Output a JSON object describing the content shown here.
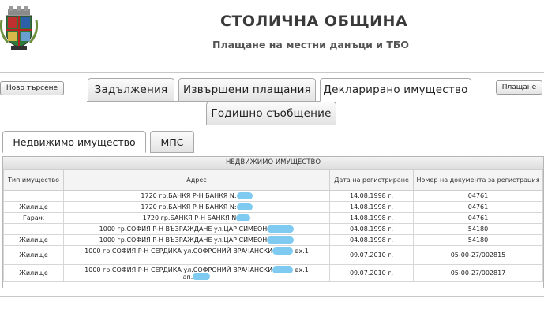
{
  "header": {
    "title": "СТОЛИЧНА ОБЩИНА",
    "subtitle": "Плащане на местни данъци и ТБО"
  },
  "buttons": {
    "new_search": "Ново търсене",
    "payment": "Плащане"
  },
  "tabs": [
    {
      "label": "Задължения",
      "active": false
    },
    {
      "label": "Извършени плащания",
      "active": false
    },
    {
      "label": "Декларирано имущество",
      "active": true
    },
    {
      "label": "Годишно съобщение",
      "active": false
    }
  ],
  "subtabs": [
    {
      "label": "Недвижимо имущество",
      "active": true
    },
    {
      "label": "МПС",
      "active": false
    }
  ],
  "panel": {
    "caption": "НЕДВИЖИМО ИМУЩЕСТВО",
    "columns": [
      "Тип имущество",
      "Адрес",
      "Дата на регистриране",
      "Номер на документа за регистрация"
    ],
    "rows": [
      {
        "type": "",
        "address": "1720 гр.БАНКЯ Р-Н БАНКЯ N:",
        "date": "14.08.1998 г.",
        "doc": "04761"
      },
      {
        "type": "Жилище",
        "address": "1720 гр.БАНКЯ Р-Н БАНКЯ N:",
        "date": "14.08.1998 г.",
        "doc": "04761"
      },
      {
        "type": "Гараж",
        "address": "1720 гр.БАНКЯ Р-Н БАНКЯ N",
        "date": "14.08.1998 г.",
        "doc": "04761"
      },
      {
        "type": "",
        "address": "1000 гр.СОФИЯ Р-Н ВЪЗРАЖДАНЕ ул.ЦАР СИМЕОН",
        "date": "04.08.1998 г.",
        "doc": "54180"
      },
      {
        "type": "Жилище",
        "address": "1000 гр.СОФИЯ Р-Н ВЪЗРАЖДАНЕ ул.ЦАР СИМЕОН",
        "date": "04.08.1998 г.",
        "doc": "54180"
      },
      {
        "type": "Жилище",
        "address": "1000 гр.СОФИЯ Р-Н СЕРДИКА ул.СОФРОНИЙ ВРАЧАНСКИ",
        "address_tail": "вх.1",
        "date": "09.07.2010 г.",
        "doc": "05-00-27/002815"
      },
      {
        "type": "Жилище",
        "address": "1000 гр.СОФИЯ Р-Н СЕРДИКА ул.СОФРОНИЙ ВРАЧАНСКИ",
        "address_tail": "вх.1",
        "address_line2": "ап.",
        "date": "09.07.2010 г.",
        "doc": "05-00-27/002817"
      }
    ]
  },
  "colors": {
    "redaction": "#7fcaf0",
    "tab_border": "#a9a9a9"
  }
}
